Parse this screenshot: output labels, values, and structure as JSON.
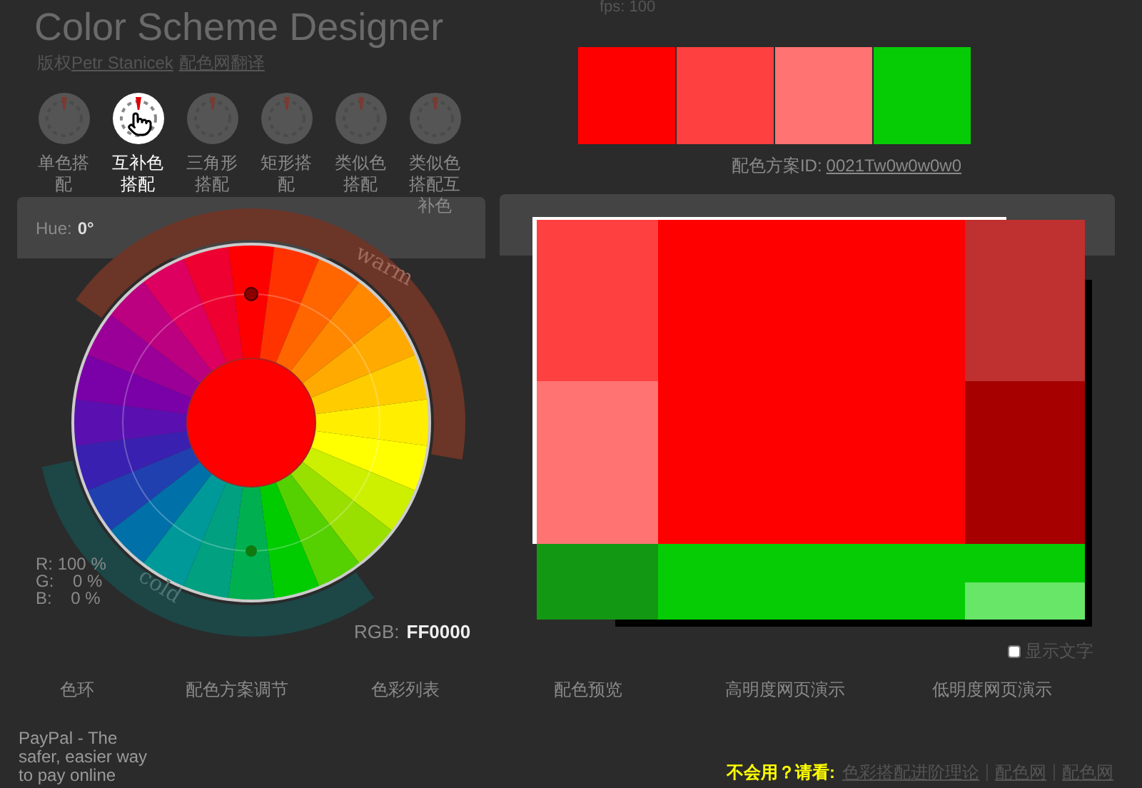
{
  "header": {
    "title": "Color Scheme Designer",
    "credit_prefix": "版权",
    "author_link": "Petr Stanicek",
    "translator_link": "配色网翻译",
    "fps": "fps: 100"
  },
  "scheme_types": [
    {
      "label": "单色搭配",
      "selected": false
    },
    {
      "label": "互补色搭配",
      "selected": true
    },
    {
      "label": "三角形搭配",
      "selected": false
    },
    {
      "label": "矩形搭配",
      "selected": false
    },
    {
      "label": "类似色搭配",
      "selected": false
    },
    {
      "label": "类似色搭配互补色",
      "selected": false
    }
  ],
  "wheel_panel": {
    "hue_label": "Hue:",
    "hue_value": "0°",
    "warm_label": "warm",
    "cold_label": "cold",
    "rgb_lines": [
      "R: 100 %",
      "G:    0 %",
      "B:    0 %"
    ],
    "rgb_label": "RGB:",
    "rgb_value": "FF0000"
  },
  "palette": {
    "swatches": [
      {
        "color": "#ff0000"
      },
      {
        "color": "#ff4040"
      },
      {
        "color": "#ff7373"
      },
      {
        "color": "#06cc06"
      }
    ],
    "id_label": "配色方案ID:",
    "id_value": "0021Tw0w0w0w0"
  },
  "preview": {
    "columns": [
      {
        "cells": [
          {
            "color": "#ff4040"
          },
          {
            "color": "#ff7373"
          },
          {
            "color": "#139813"
          }
        ]
      },
      {
        "cells": [
          {
            "color": "#ff0000"
          },
          {
            "color": "#ff0000"
          },
          {
            "color": "#06cc06"
          }
        ]
      },
      {
        "cells": [
          {
            "color": "#bf3030"
          },
          {
            "color": "#a60000"
          },
          {
            "color": "#06cc06"
          },
          {
            "color": "#67e667"
          }
        ]
      }
    ],
    "show_text": {
      "label": "显示文字",
      "checked": false
    }
  },
  "tabs": [
    {
      "label": "色环",
      "selected": false
    },
    {
      "label": "配色方案调节",
      "selected": false
    },
    {
      "label": "色彩列表",
      "selected": false
    },
    {
      "label": "配色预览",
      "selected": false
    },
    {
      "label": "高明度网页演示",
      "selected": false
    },
    {
      "label": "低明度网页演示",
      "selected": false
    }
  ],
  "footer": {
    "paypal_alt": "PayPal - The safer, easier way to pay online",
    "help_prefix": "不会用？请看:",
    "links": [
      "色彩搭配进阶理论",
      "配色网",
      "配色网"
    ]
  }
}
